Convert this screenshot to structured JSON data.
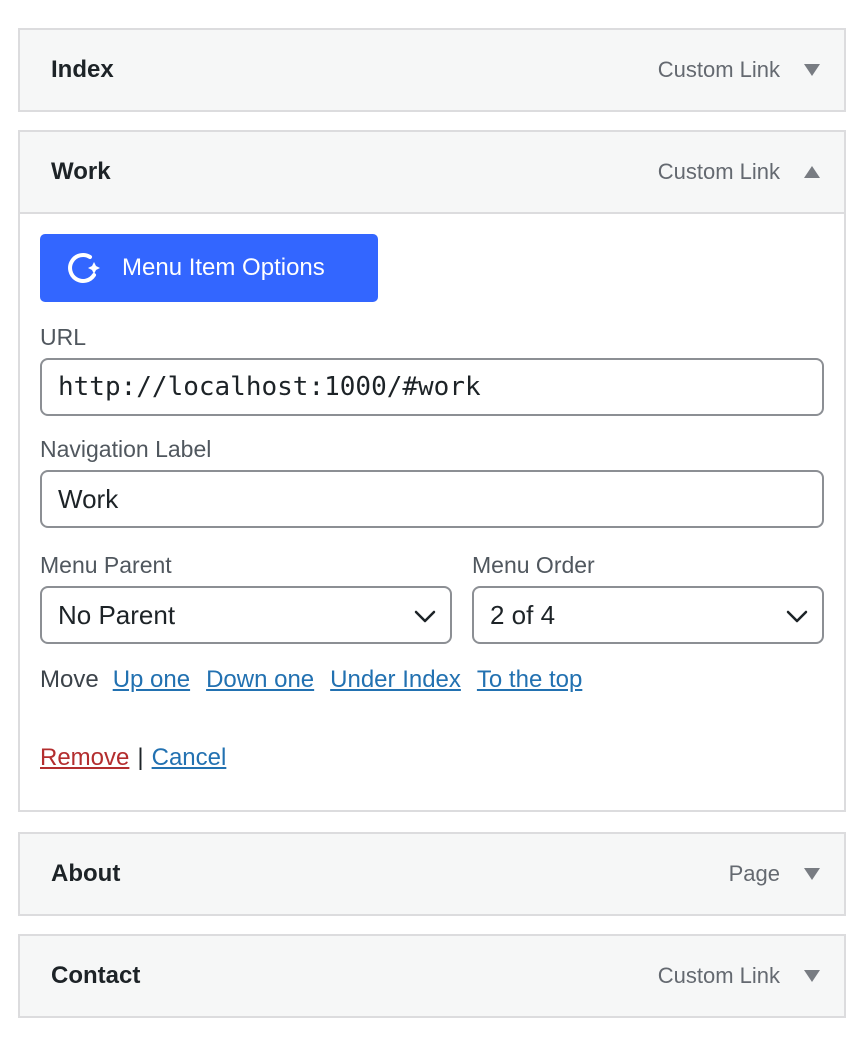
{
  "menu_items": [
    {
      "title": "Index",
      "type": "Custom Link",
      "expanded": false
    },
    {
      "title": "Work",
      "type": "Custom Link",
      "expanded": true
    },
    {
      "title": "About",
      "type": "Page",
      "expanded": false
    },
    {
      "title": "Contact",
      "type": "Custom Link",
      "expanded": false
    }
  ],
  "work_settings": {
    "options_button_label": "Menu Item Options",
    "url_label": "URL",
    "url_value": "http://localhost:1000/#work",
    "nav_label_label": "Navigation Label",
    "nav_label_value": "Work",
    "menu_parent_label": "Menu Parent",
    "menu_parent_value": "No Parent",
    "menu_order_label": "Menu Order",
    "menu_order_value": "2 of 4",
    "move_label": "Move",
    "move_links": [
      "Up one",
      "Down one",
      "Under Index",
      "To the top"
    ],
    "remove_label": "Remove",
    "separator": "|",
    "cancel_label": "Cancel"
  },
  "colors": {
    "accent_button": "#3366ff",
    "link": "#2271b1",
    "remove": "#b32d2e"
  },
  "icons": {
    "options_button": "spinner-sparkle-icon",
    "collapsed": "triangle-down-icon",
    "expanded": "triangle-up-icon"
  }
}
